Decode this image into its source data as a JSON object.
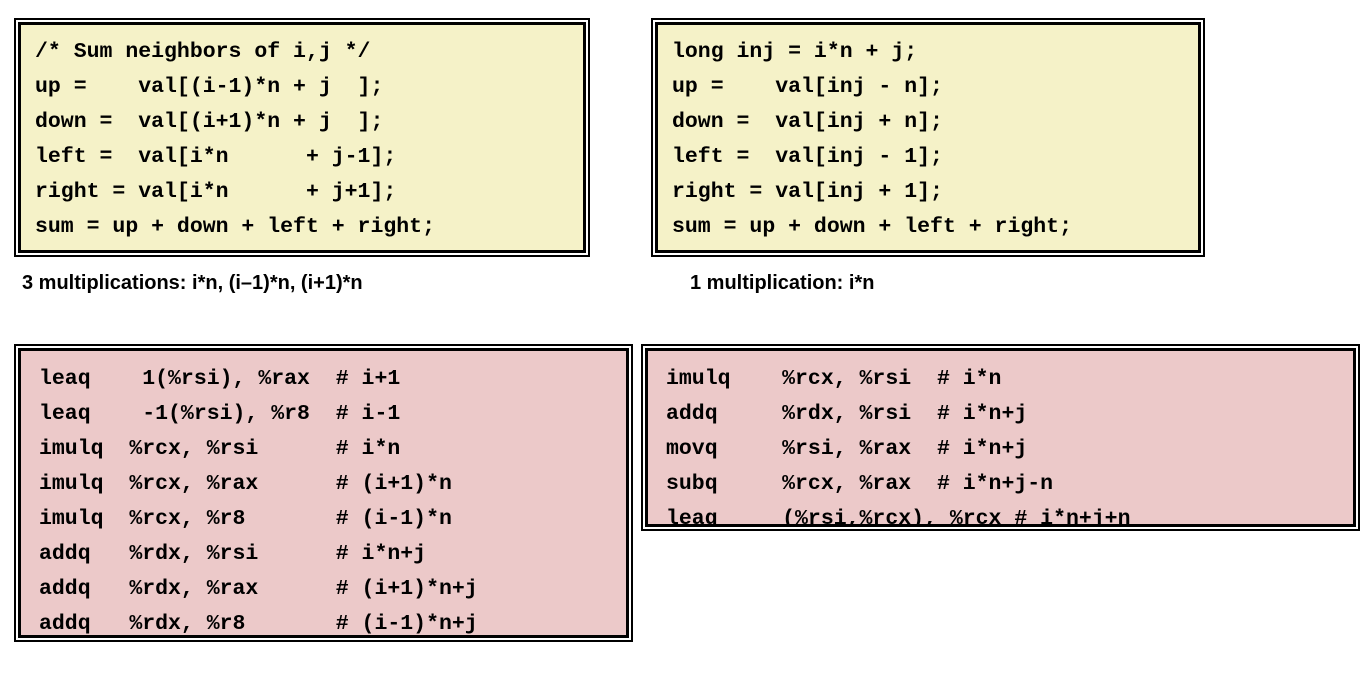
{
  "slide": {
    "background_color": "#ffffff",
    "code_box_color": "#f5f2c8",
    "asm_box_color": "#ecc9c9",
    "border_color": "#000000",
    "text_color": "#000000"
  },
  "c_code_left": {
    "lines": [
      "/* Sum neighbors of i,j */",
      "up =    val[(i-1)*n + j  ];",
      "down =  val[(i+1)*n + j  ];",
      "left =  val[i*n      + j-1];",
      "right = val[i*n      + j+1];",
      "sum = up + down + left + right;"
    ],
    "text": "/* Sum neighbors of i,j */\nup =    val[(i-1)*n + j  ];\ndown =  val[(i+1)*n + j  ];\nleft =  val[i*n      + j-1];\nright = val[i*n      + j+1];\nsum = up + down + left + right;"
  },
  "c_code_right": {
    "lines": [
      "long inj = i*n + j;",
      "up =    val[inj - n];",
      "down =  val[inj + n];",
      "left =  val[inj - 1];",
      "right = val[inj + 1];",
      "sum = up + down + left + right;"
    ],
    "text": "long inj = i*n + j;\nup =    val[inj - n];\ndown =  val[inj + n];\nleft =  val[inj - 1];\nright = val[inj + 1];\nsum = up + down + left + right;"
  },
  "caption_left": "3 multiplications: i*n, (i–1)*n, (i+1)*n",
  "caption_right": "1 multiplication: i*n",
  "asm_left": {
    "lines": [
      "leaq    1(%rsi), %rax  # i+1",
      "leaq    -1(%rsi), %r8  # i-1",
      "imulq  %rcx, %rsi      # i*n",
      "imulq  %rcx, %rax      # (i+1)*n",
      "imulq  %rcx, %r8       # (i-1)*n",
      "addq   %rdx, %rsi      # i*n+j",
      "addq   %rdx, %rax      # (i+1)*n+j",
      "addq   %rdx, %r8       # (i-1)*n+j"
    ],
    "text": "leaq    1(%rsi), %rax  # i+1\nleaq    -1(%rsi), %r8  # i-1\nimulq  %rcx, %rsi      # i*n\nimulq  %rcx, %rax      # (i+1)*n\nimulq  %rcx, %r8       # (i-1)*n\naddq   %rdx, %rsi      # i*n+j\naddq   %rdx, %rax      # (i+1)*n+j\naddq   %rdx, %r8       # (i-1)*n+j"
  },
  "asm_right": {
    "lines": [
      "imulq    %rcx, %rsi  # i*n",
      "addq     %rdx, %rsi  # i*n+j",
      "movq     %rsi, %rax  # i*n+j",
      "subq     %rcx, %rax  # i*n+j-n",
      "leaq     (%rsi,%rcx), %rcx # i*n+j+n"
    ],
    "text": "imulq    %rcx, %rsi  # i*n\naddq     %rdx, %rsi  # i*n+j\nmovq     %rsi, %rax  # i*n+j\nsubq     %rcx, %rax  # i*n+j-n\nleaq     (%rsi,%rcx), %rcx # i*n+j+n"
  }
}
